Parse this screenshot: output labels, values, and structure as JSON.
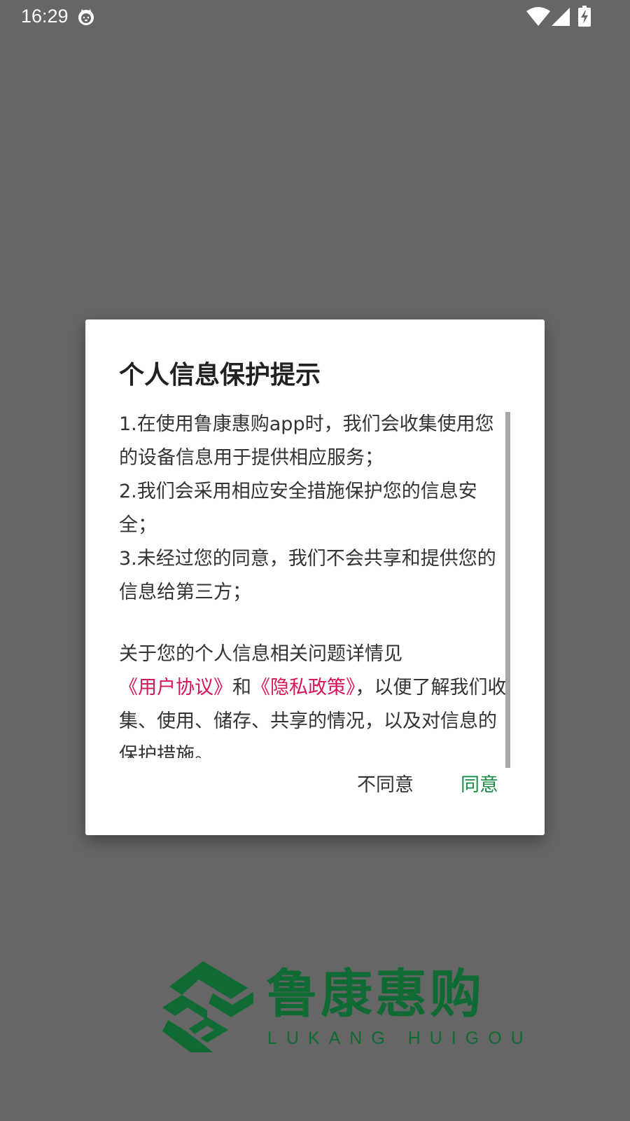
{
  "status_bar": {
    "time": "16:29",
    "icons": [
      "cat-notification-icon",
      "wifi-icon",
      "cellular-signal-icon",
      "battery-charging-icon"
    ]
  },
  "dialog": {
    "title": "个人信息保护提示",
    "items": [
      "1.在使用鲁康惠购app时，我们会收集使用您的设备信息用于提供相应服务；",
      "2.我们会采用相应安全措施保护您的信息安全；",
      "3.未经过您的同意，我们不会共享和提供您的信息给第三方；"
    ],
    "notice": {
      "prefix": "关于您的个人信息相关问题详情见",
      "user_agreement_link": "《用户协议》",
      "connector": "和",
      "privacy_policy_link": "《隐私政策》",
      "suffix": "，以便了解我们收集、使用、储存、共享的情况，以及对信息的保护措施。"
    },
    "buttons": {
      "disagree": "不同意",
      "agree": "同意"
    }
  },
  "logo": {
    "name_cn": "鲁康惠购",
    "name_en": "LUKANG HUIGOU"
  },
  "colors": {
    "scrim": "#666666",
    "brand_green": "#0f6b33",
    "agree_green": "#1b8a46",
    "link_pink": "#d8155a",
    "dialog_bg": "#ffffff",
    "scrollbar": "#a7a7a7"
  }
}
